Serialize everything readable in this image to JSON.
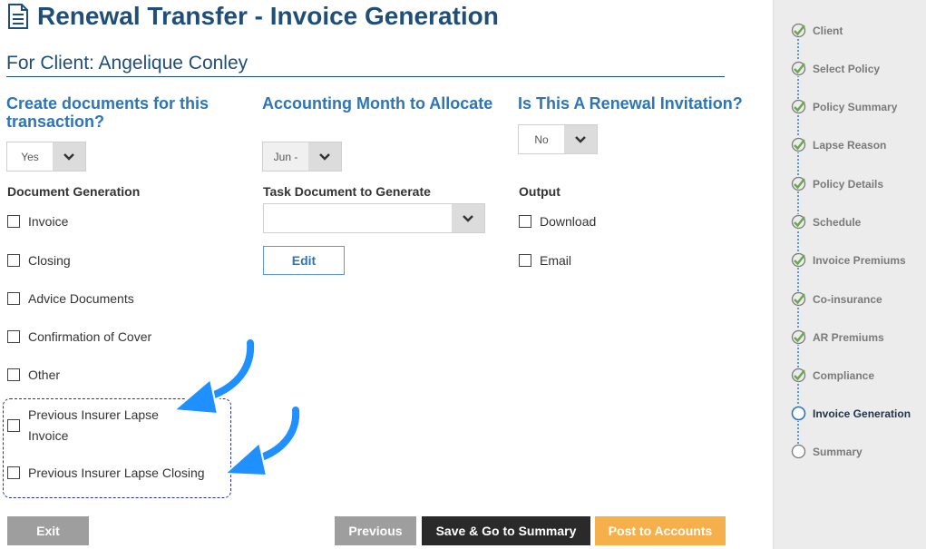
{
  "header": {
    "title": "Renewal Transfer - Invoice Generation",
    "client_line": "For Client: Angelique Conley"
  },
  "columns": {
    "create_docs": {
      "heading": "Create documents for this transaction?",
      "select_value": "Yes",
      "section_label": "Document Generation",
      "checkboxes": [
        {
          "label": "Invoice",
          "checked": false
        },
        {
          "label": "Closing",
          "checked": false
        },
        {
          "label": "Advice Documents",
          "checked": false
        },
        {
          "label": "Confirmation of Cover",
          "checked": false
        },
        {
          "label": "Other",
          "checked": false
        },
        {
          "label": "Previous Insurer Lapse Invoice",
          "checked": false
        },
        {
          "label": "Previous Insurer Lapse Closing",
          "checked": false
        }
      ]
    },
    "accounting_month": {
      "heading": "Accounting Month to Allocate",
      "select_value": "Jun -",
      "section_label": "Task Document to Generate",
      "task_select_value": "",
      "edit_label": "Edit"
    },
    "renewal_invitation": {
      "heading": "Is This A Renewal Invitation?",
      "select_value": "No",
      "section_label": "Output",
      "checkboxes": [
        {
          "label": "Download",
          "checked": false
        },
        {
          "label": "Email",
          "checked": false
        }
      ]
    }
  },
  "buttons": {
    "exit": "Exit",
    "previous": "Previous",
    "save_summary": "Save & Go to Summary",
    "post_accounts": "Post to Accounts"
  },
  "sidebar": {
    "steps": [
      {
        "label": "Client",
        "state": "done"
      },
      {
        "label": "Select Policy",
        "state": "done"
      },
      {
        "label": "Policy Summary",
        "state": "done"
      },
      {
        "label": "Lapse Reason",
        "state": "done"
      },
      {
        "label": "Policy Details",
        "state": "done"
      },
      {
        "label": "Schedule",
        "state": "done"
      },
      {
        "label": "Invoice Premiums",
        "state": "done"
      },
      {
        "label": "Co-insurance",
        "state": "done"
      },
      {
        "label": "AR Premiums",
        "state": "done"
      },
      {
        "label": "Compliance",
        "state": "done"
      },
      {
        "label": "Invoice Generation",
        "state": "active"
      },
      {
        "label": "Summary",
        "state": "pending"
      }
    ]
  },
  "colors": {
    "title": "#1f4e79",
    "heading": "#2e75b6",
    "check": "#6aa84f",
    "annotation_arrow": "#1e90ff",
    "post_button": "#f5b04c",
    "save_button": "#2a2a2a"
  }
}
